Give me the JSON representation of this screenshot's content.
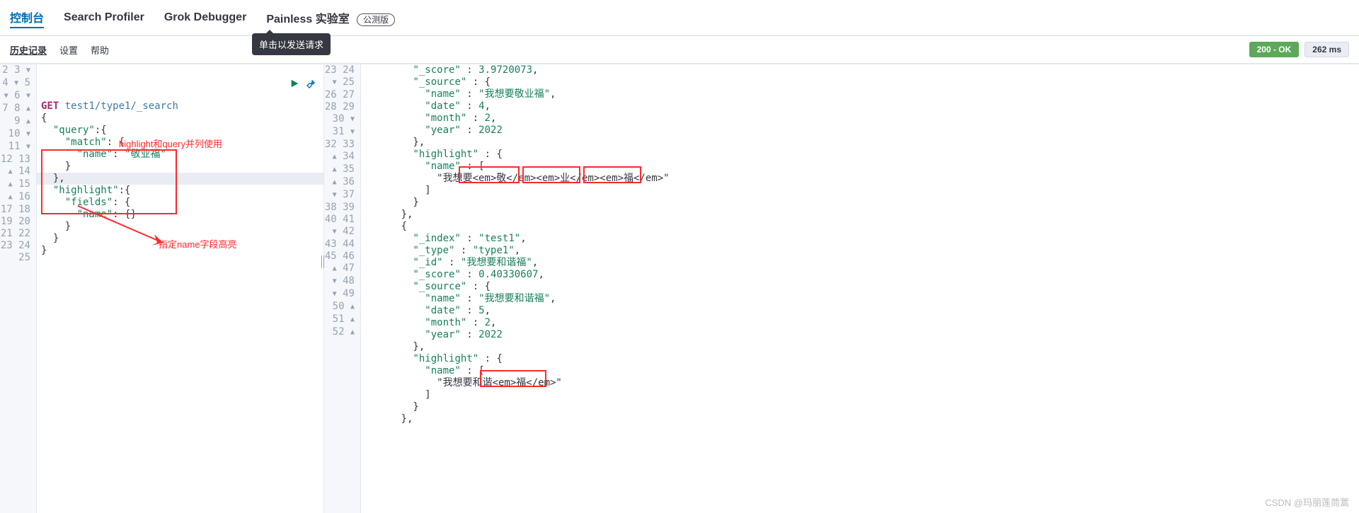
{
  "tabs": {
    "console": "控制台",
    "profiler": "Search Profiler",
    "grok": "Grok Debugger",
    "painless": "Painless 实验室",
    "beta": "公测版"
  },
  "subnav": {
    "history": "历史记录",
    "settings": "设置",
    "help": "帮助"
  },
  "tooltip": "单击以发送请求",
  "status": {
    "label": "200 - OK",
    "time": "262 ms"
  },
  "annotations": {
    "a1": "highlight和query并列使用",
    "a2": "指定name字段高亮"
  },
  "request": {
    "method": "GET",
    "path": "test1/type1/_search",
    "lines": [
      "GET test1/type1/_search",
      "{",
      "  \"query\":{",
      "    \"match\": {",
      "      \"name\": \"敬业福\"",
      "    }",
      "  },",
      "  \"highlight\":{",
      "    \"fields\": {",
      "      \"name\": {}",
      "    }",
      "  }",
      "}"
    ],
    "gutter": [
      "2",
      "3",
      "4",
      "5",
      "6",
      "7",
      "8",
      "9",
      "10",
      "11",
      "12",
      "13",
      "14",
      "15",
      "16",
      "17",
      "18",
      "19",
      "20",
      "21",
      "22",
      "23",
      "24",
      "25"
    ]
  },
  "response": {
    "gutter": [
      "23",
      "24",
      "25",
      "26",
      "27",
      "28",
      "29",
      "30",
      "31",
      "32",
      "33",
      "34",
      "35",
      "36",
      "37",
      "38",
      "39",
      "40",
      "41",
      "42",
      "43",
      "44",
      "45",
      "46",
      "47",
      "48",
      "49",
      "50",
      "51",
      "52"
    ],
    "lines": [
      "        \"_score\" : 3.9720073,",
      "        \"_source\" : {",
      "          \"name\" : \"我想要敬业福\",",
      "          \"date\" : 4,",
      "          \"month\" : 2,",
      "          \"year\" : 2022",
      "        },",
      "        \"highlight\" : {",
      "          \"name\" : [",
      "            \"我想要<em>敬</em><em>业</em><em>福</em>\"",
      "          ]",
      "        }",
      "      },",
      "      {",
      "        \"_index\" : \"test1\",",
      "        \"_type\" : \"type1\",",
      "        \"_id\" : \"我想要和谐福\",",
      "        \"_score\" : 0.40330607,",
      "        \"_source\" : {",
      "          \"name\" : \"我想要和谐福\",",
      "          \"date\" : 5,",
      "          \"month\" : 2,",
      "          \"year\" : 2022",
      "        },",
      "        \"highlight\" : {",
      "          \"name\" : [",
      "            \"我想要和谐<em>福</em>\"",
      "          ]",
      "        }",
      "      },"
    ]
  },
  "watermark": "CSDN @玛丽莲茼蒿"
}
